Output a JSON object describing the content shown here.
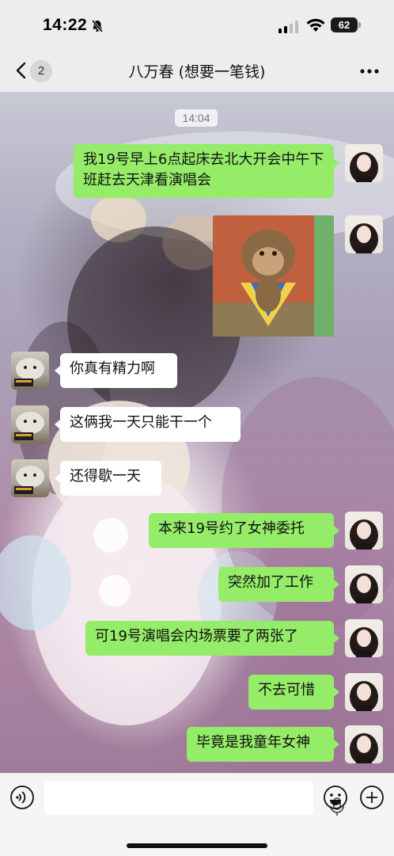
{
  "status_bar": {
    "time": "14:22",
    "battery": "62"
  },
  "nav": {
    "back_badge": "2",
    "title": "八万春 (想要一笔钱)"
  },
  "chat": {
    "timestamp": "14:04",
    "messages": [
      {
        "from": "me",
        "text": "我19号早上6点起床去北大开会中午下班赶去天津看演唱会"
      },
      {
        "from": "me",
        "type": "sticker"
      },
      {
        "from": "other",
        "text": "你真有精力啊"
      },
      {
        "from": "other",
        "text": "这俩我一天只能干一个"
      },
      {
        "from": "other",
        "text": "还得歇一天"
      },
      {
        "from": "me",
        "text": "本来19号约了女神委托"
      },
      {
        "from": "me",
        "text": "突然加了工作"
      },
      {
        "from": "me",
        "text": "可19号演唱会内场票要了两张了"
      },
      {
        "from": "me",
        "text": "不去可惜"
      },
      {
        "from": "me",
        "text": "毕竟是我童年女神"
      }
    ]
  },
  "colors": {
    "my_bubble": "#95ec69",
    "their_bubble": "#ffffff",
    "bar_bg": "#ededed"
  },
  "icons": [
    "back-chevron-icon",
    "more-icon",
    "voice-icon",
    "mic-icon",
    "emoji-icon",
    "plus-icon",
    "mute-bell-icon",
    "wifi-icon",
    "signal-icon"
  ]
}
